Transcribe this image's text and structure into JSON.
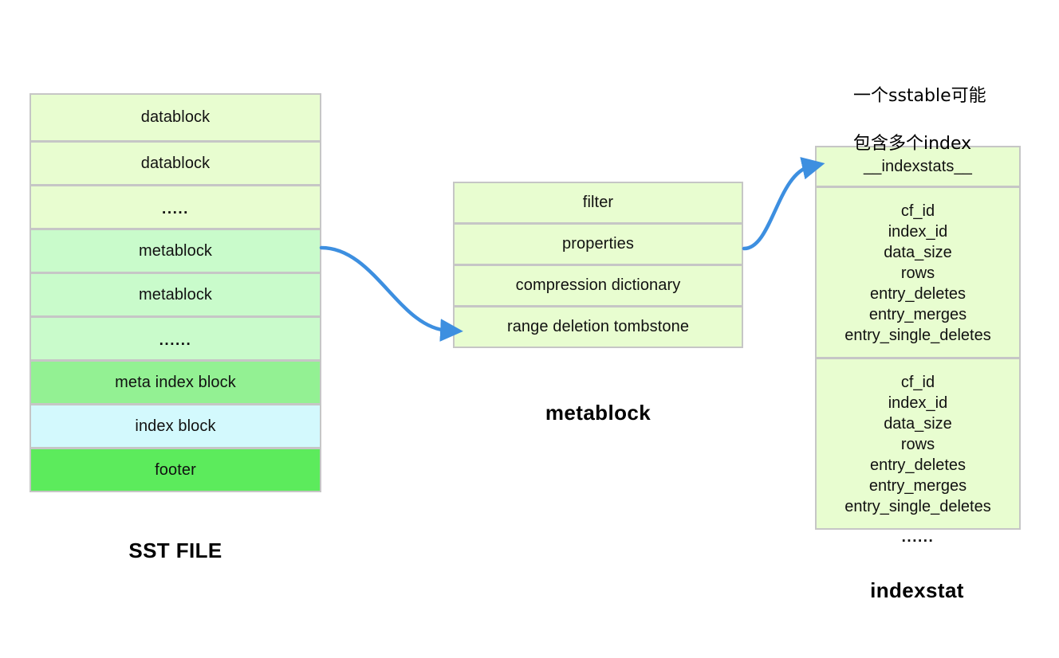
{
  "diagram": {
    "title_sst": "SST FILE",
    "title_metablock": "metablock",
    "title_indexstat": "indexstat"
  },
  "sst_file": {
    "label": "SST FILE",
    "rows": [
      {
        "label": "datablock",
        "color": "#e8fdd0"
      },
      {
        "label": "datablock",
        "color": "#e8fdd0"
      },
      {
        "label": ".....",
        "color": "#e8fdd0"
      },
      {
        "label": "metablock",
        "color": "#c9fbcb"
      },
      {
        "label": "metablock",
        "color": "#c9fbcb"
      },
      {
        "label": "......",
        "color": "#c9fbcb"
      },
      {
        "label": "meta index block",
        "color": "#93f193"
      },
      {
        "label": "index block",
        "color": "#d3f9fd"
      },
      {
        "label": "footer",
        "color": "#5ceb5c"
      }
    ]
  },
  "metablock": {
    "label": "metablock",
    "rows": [
      {
        "label": "filter",
        "color": "#e8fdd0"
      },
      {
        "label": "properties",
        "color": "#e8fdd0"
      },
      {
        "label": "compression dictionary",
        "color": "#e8fdd0"
      },
      {
        "label": "range deletion tombstone",
        "color": "#e8fdd0"
      }
    ]
  },
  "indexstat": {
    "label": "indexstat",
    "header": "__indexstats__",
    "trailing_dots": "......",
    "entries": [
      {
        "fields": [
          "cf_id",
          "index_id",
          "data_size",
          "rows",
          "entry_deletes",
          "entry_merges",
          "entry_single_deletes"
        ]
      },
      {
        "fields": [
          "cf_id",
          "index_id",
          "data_size",
          "rows",
          "entry_deletes",
          "entry_merges",
          "entry_single_deletes"
        ]
      }
    ]
  },
  "annotation": {
    "line1": "一个sstable可能",
    "line2": "包含多个index"
  },
  "colors": {
    "arrow": "#3d8fe0",
    "border": "#c6c6c6",
    "pale_green": "#e8fdd0",
    "mint_green": "#c9fbcb",
    "green": "#93f193",
    "cyan": "#d3f9fd",
    "bright_green": "#5ceb5c",
    "text": "#111111",
    "background": "#ffffff"
  }
}
